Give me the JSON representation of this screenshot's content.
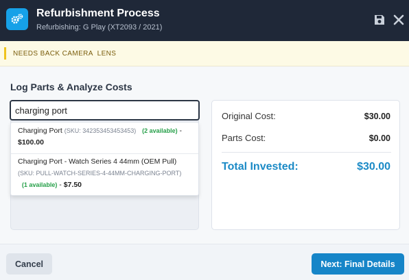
{
  "header": {
    "title": "Refurbishment Process",
    "subtitle": "Refurbishing: G Play (XT2093 / 2021)",
    "app_icon": "gears-icon",
    "save_icon": "save-icon",
    "close_icon": "close-icon"
  },
  "notice": {
    "text": "NEEDS BACK CAMERA  LENS",
    "accent": "#efc31d"
  },
  "section": {
    "title": "Log Parts & Analyze Costs"
  },
  "search": {
    "value": "charging port"
  },
  "results": [
    {
      "name": "Charging Port",
      "sku": "(SKU: 342353453453453)",
      "availability": "(2 available)",
      "separator": "-",
      "price": "$100.00"
    },
    {
      "name": "Charging Port - Watch Series 4 44mm (OEM Pull)",
      "sku": "(SKU: PULL-WATCH-SERIES-4-44MM-CHARGING-PORT)",
      "availability": "(1 available)",
      "separator": "-",
      "price": "$7.50"
    }
  ],
  "costs": {
    "original_label": "Original Cost:",
    "original_value": "$30.00",
    "parts_label": "Parts Cost:",
    "parts_value": "$0.00",
    "total_label": "Total Invested:",
    "total_value": "$30.00"
  },
  "footer": {
    "cancel_label": "Cancel",
    "next_label": "Next: Final Details"
  },
  "colors": {
    "header_bg": "#1f2838",
    "accent_blue": "#1685c8",
    "total_blue": "#1b8ac6",
    "available_green": "#27a04a"
  }
}
